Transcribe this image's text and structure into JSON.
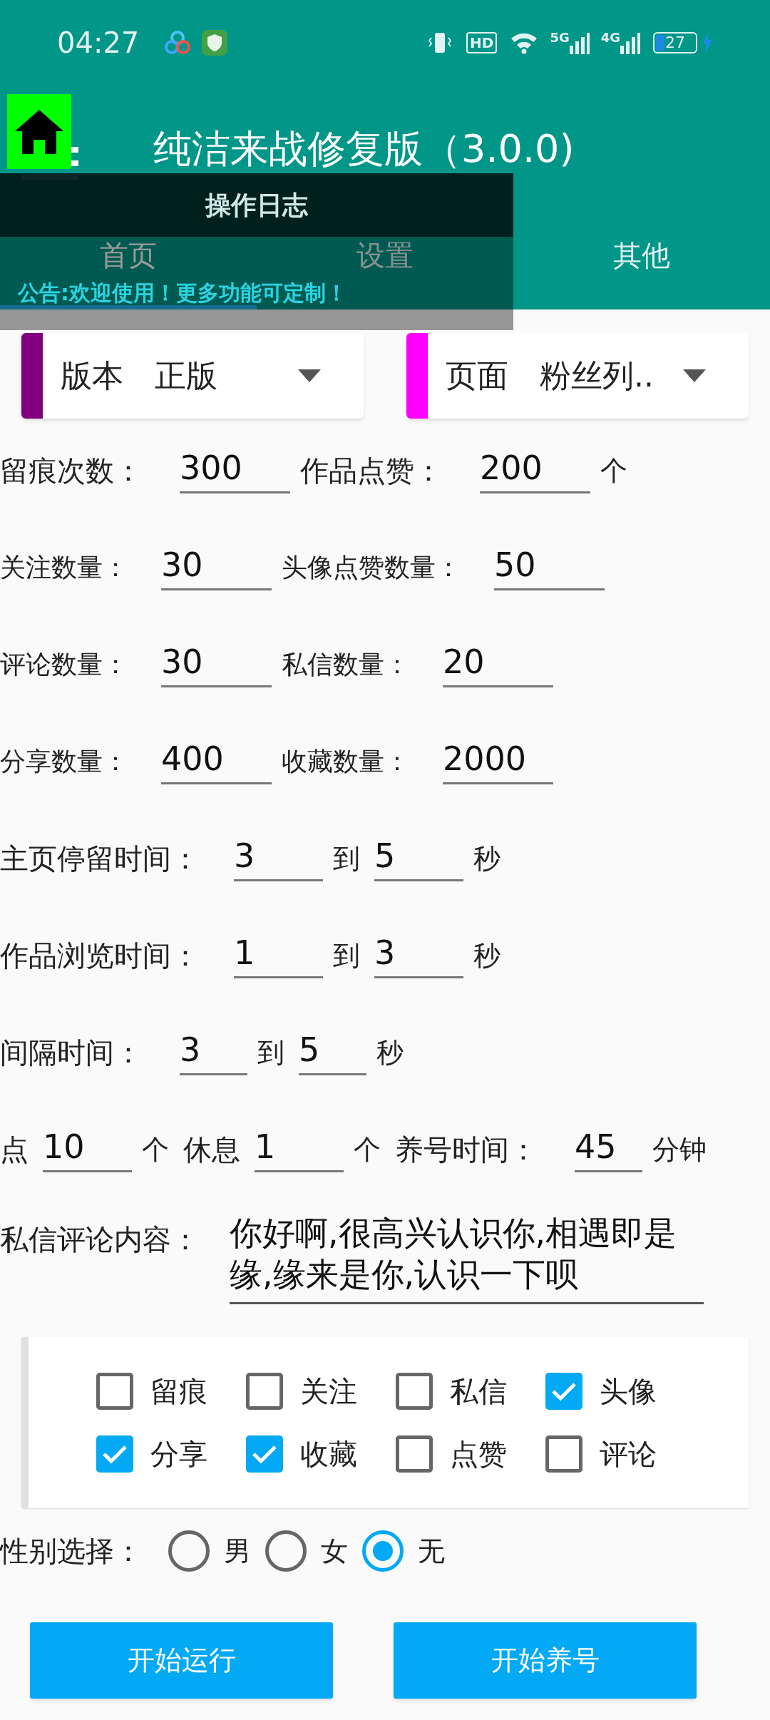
{
  "status_bar": {
    "time": "04:27",
    "hd_label": "HD",
    "networks": [
      "5G",
      "4G"
    ],
    "battery": "27"
  },
  "app_bar": {
    "title": "纯洁来战修复版（3.0.0)"
  },
  "log_overlay": {
    "title": "操作日志",
    "notice": "公告:欢迎使用！更多功能可定制！"
  },
  "tabs": [
    {
      "label": "首页",
      "selected": true
    },
    {
      "label": "设置",
      "selected": false
    },
    {
      "label": "其他",
      "selected": false
    }
  ],
  "spinners": [
    {
      "label": "版本",
      "value": "正版",
      "color": "#800080"
    },
    {
      "label": "页面",
      "value": "粉丝列..",
      "color": "#ff00ff"
    }
  ],
  "form_rows": [
    [
      {
        "kind": "label",
        "text": "留痕次数："
      },
      {
        "kind": "field",
        "value": "300"
      },
      {
        "kind": "label",
        "text": "作品点赞："
      },
      {
        "kind": "field",
        "value": "200"
      },
      {
        "kind": "unit",
        "text": "个"
      }
    ],
    [
      {
        "kind": "label",
        "text": "关注数量："
      },
      {
        "kind": "field",
        "value": "30"
      },
      {
        "kind": "label",
        "text": "头像点赞数量："
      },
      {
        "kind": "field",
        "value": "50"
      }
    ],
    [
      {
        "kind": "label",
        "text": "评论数量："
      },
      {
        "kind": "field",
        "value": "30"
      },
      {
        "kind": "label",
        "text": "私信数量："
      },
      {
        "kind": "field",
        "value": "20"
      }
    ],
    [
      {
        "kind": "label",
        "text": "分享数量："
      },
      {
        "kind": "field",
        "value": "400"
      },
      {
        "kind": "label",
        "text": "收藏数量："
      },
      {
        "kind": "field",
        "value": "2000"
      }
    ],
    [
      {
        "kind": "label",
        "text": "主页停留时间："
      },
      {
        "kind": "field",
        "value": "3"
      },
      {
        "kind": "unit",
        "text": "到"
      },
      {
        "kind": "field",
        "value": "5"
      },
      {
        "kind": "unit",
        "text": "秒"
      }
    ],
    [
      {
        "kind": "label",
        "text": "作品浏览时间："
      },
      {
        "kind": "field",
        "value": "1"
      },
      {
        "kind": "unit",
        "text": "到"
      },
      {
        "kind": "field",
        "value": "3"
      },
      {
        "kind": "unit",
        "text": "秒"
      }
    ],
    [
      {
        "kind": "label",
        "text": "间隔时间："
      },
      {
        "kind": "field",
        "value": "3"
      },
      {
        "kind": "unit",
        "text": "到"
      },
      {
        "kind": "field",
        "value": "5"
      },
      {
        "kind": "unit",
        "text": "秒"
      }
    ],
    [
      {
        "kind": "label",
        "text": "点"
      },
      {
        "kind": "field",
        "value": "10"
      },
      {
        "kind": "unit",
        "text": "个"
      },
      {
        "kind": "label",
        "text": "休息"
      },
      {
        "kind": "field",
        "value": "1"
      },
      {
        "kind": "unit",
        "text": "个"
      },
      {
        "kind": "label",
        "text": "养号时间："
      },
      {
        "kind": "field",
        "value": "45"
      },
      {
        "kind": "unit",
        "text": "分钟"
      }
    ]
  ],
  "message": {
    "label": "私信评论内容：",
    "value": "你好啊,很高兴认识你,相遇即是缘,缘来是你,认识一下呗"
  },
  "options": [
    {
      "label": "留痕",
      "checked": false
    },
    {
      "label": "关注",
      "checked": false
    },
    {
      "label": "私信",
      "checked": false
    },
    {
      "label": "头像",
      "checked": true
    },
    {
      "label": "分享",
      "checked": true
    },
    {
      "label": "收藏",
      "checked": true
    },
    {
      "label": "点赞",
      "checked": false
    },
    {
      "label": "评论",
      "checked": false
    }
  ],
  "gender": {
    "label": "性别选择：",
    "options": [
      {
        "label": "男",
        "selected": false
      },
      {
        "label": "女",
        "selected": false
      },
      {
        "label": "无",
        "selected": true
      }
    ]
  },
  "buttons": [
    "开始运行",
    "开始养号"
  ]
}
